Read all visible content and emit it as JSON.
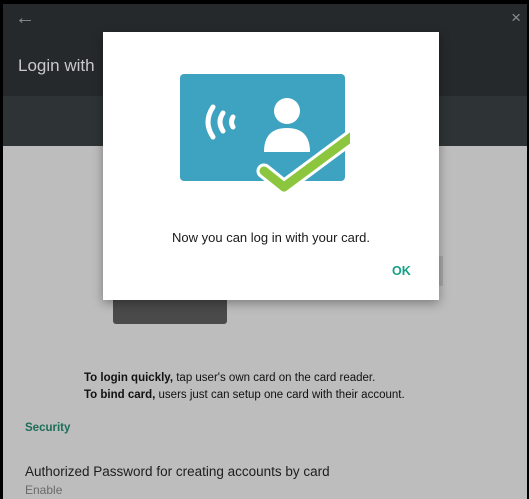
{
  "appbar": {
    "back_icon": "←",
    "close_icon": "×",
    "title": "Login with"
  },
  "content": {
    "hint_login_bold": "To login quickly,",
    "hint_login_rest": " tap user's own card on the card reader.",
    "hint_bind_bold": "To bind card,",
    "hint_bind_rest": " users just can setup one card with their account.",
    "security_header": "Security",
    "setting_title": "Authorized Password for creating accounts by card",
    "setting_subtitle": "Enable"
  },
  "dialog": {
    "message": "Now you can log in with your card.",
    "ok_label": "OK",
    "graphic_icon": "contactless-card-check-icon"
  },
  "colors": {
    "accent": "#17a085",
    "card_blue": "#3ea3c0",
    "check_green": "#8cc63f",
    "appbar": "#26292b"
  }
}
